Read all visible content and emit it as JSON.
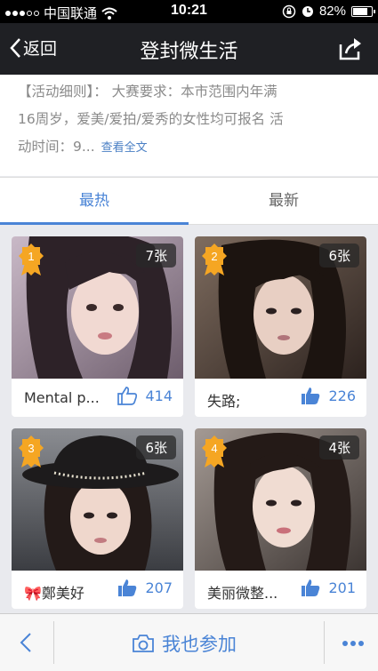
{
  "status_bar": {
    "carrier": "中国联通",
    "time": "10:21",
    "battery": "82%",
    "battery_level": 0.82
  },
  "nav": {
    "back_label": "返回",
    "title": "登封微生活"
  },
  "description": {
    "line1": "【活动细则】： 大赛要求：本市范围内年满",
    "line2": "16周岁，爱美/爱拍/爱秀的女性均可报名 活",
    "line3": "动时间：9...",
    "more_label": "查看全文"
  },
  "tabs": [
    {
      "label": "最热"
    },
    {
      "label": "最新"
    }
  ],
  "entries": [
    {
      "rank": "1",
      "count": "7张",
      "name": "Mental p...",
      "likes": "414"
    },
    {
      "rank": "2",
      "count": "6张",
      "name": "失路;",
      "likes": "226"
    },
    {
      "rank": "3",
      "count": "6张",
      "name": "🎀鄭美好",
      "likes": "207"
    },
    {
      "rank": "4",
      "count": "4张",
      "name": "美丽微整...",
      "likes": "201"
    }
  ],
  "bottom": {
    "join_label": "我也参加"
  },
  "colors": {
    "accent": "#4a84d6",
    "nav_bg": "#1f2024",
    "medal": "#f5a623"
  }
}
